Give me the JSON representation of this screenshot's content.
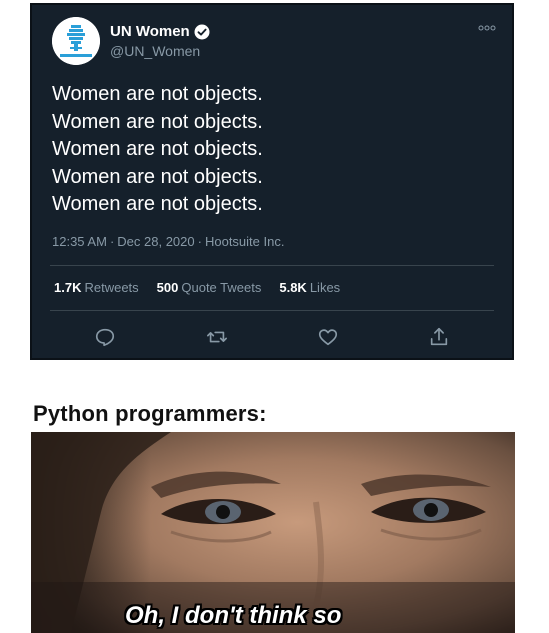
{
  "tweet": {
    "display_name": "UN Women",
    "handle": "@UN_Women",
    "lines": [
      "Women are not objects.",
      "Women are not objects.",
      "Women are not objects.",
      "Women are not objects.",
      "Women are not objects."
    ],
    "time": "12:35 AM",
    "date": "Dec 28, 2020",
    "source": "Hootsuite Inc.",
    "separator": "·",
    "stats": {
      "retweets_count": "1.7K",
      "retweets_label": "Retweets",
      "quote_count": "500",
      "quote_label": "Quote Tweets",
      "likes_count": "5.8K",
      "likes_label": "Likes"
    },
    "icons": [
      "more-icon",
      "verified-badge-icon",
      "reply-icon",
      "retweet-icon",
      "like-icon",
      "share-icon"
    ],
    "colors": {
      "background": "#15202b",
      "text": "#ffffff",
      "secondary_text": "#8899a6",
      "divider": "#38444d",
      "verified": "#ffffff",
      "logo_blue": "#2a9fd8"
    }
  },
  "meme": {
    "caption": "Python programmers:",
    "subtitle": "Oh, I don't think so"
  }
}
